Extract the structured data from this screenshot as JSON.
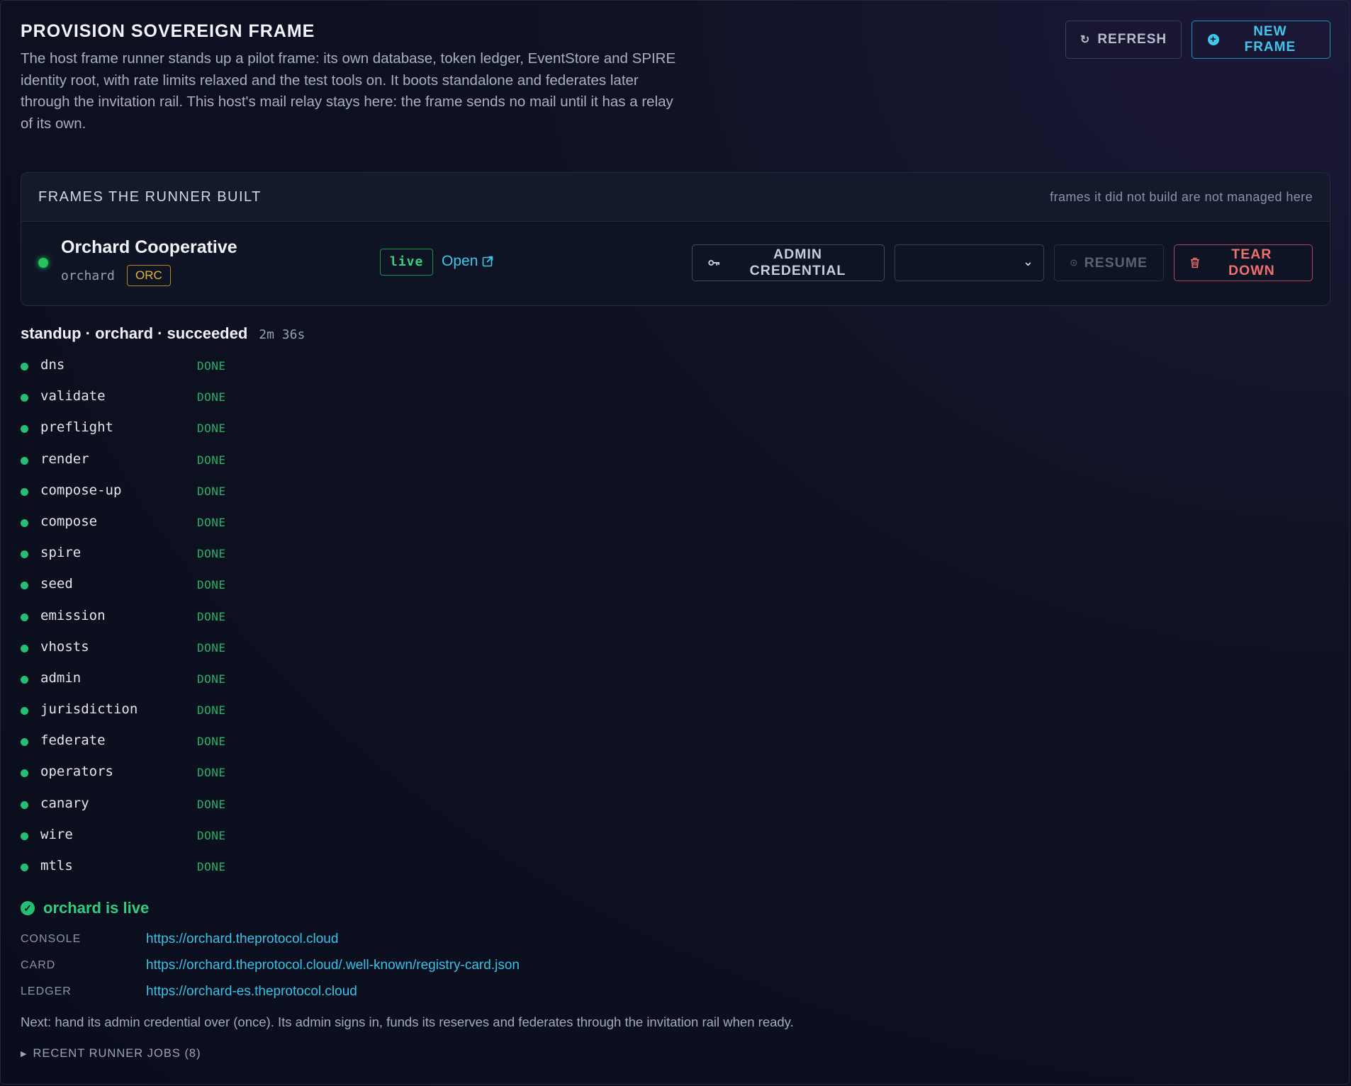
{
  "header": {
    "title": "PROVISION SOVEREIGN FRAME",
    "description": "The host frame runner stands up a pilot frame: its own database, token ledger, EventStore and SPIRE identity root, with rate limits relaxed and the test tools on. It boots standalone and federates later through the invitation rail. This host's mail relay stays here: the frame sends no mail until it has a relay of its own.",
    "refresh_label": "REFRESH",
    "new_frame_label": "NEW FRAME"
  },
  "frames_panel": {
    "title": "FRAMES THE RUNNER BUILT",
    "note": "frames it did not build are not managed here",
    "frame": {
      "name": "Orchard Cooperative",
      "slug": "orchard",
      "tag": "ORC",
      "status": "live",
      "open_label": "Open",
      "admin_label": "ADMIN CREDENTIAL",
      "select_value": "",
      "resume_label": "RESUME",
      "teardown_label": "TEAR DOWN"
    }
  },
  "job": {
    "title": "standup · orchard · succeeded",
    "duration": "2m 36s",
    "steps": [
      {
        "name": "dns",
        "state": "DONE"
      },
      {
        "name": "validate",
        "state": "DONE"
      },
      {
        "name": "preflight",
        "state": "DONE"
      },
      {
        "name": "render",
        "state": "DONE"
      },
      {
        "name": "compose-up",
        "state": "DONE"
      },
      {
        "name": "compose",
        "state": "DONE"
      },
      {
        "name": "spire",
        "state": "DONE"
      },
      {
        "name": "seed",
        "state": "DONE"
      },
      {
        "name": "emission",
        "state": "DONE"
      },
      {
        "name": "vhosts",
        "state": "DONE"
      },
      {
        "name": "admin",
        "state": "DONE"
      },
      {
        "name": "jurisdiction",
        "state": "DONE"
      },
      {
        "name": "federate",
        "state": "DONE"
      },
      {
        "name": "operators",
        "state": "DONE"
      },
      {
        "name": "canary",
        "state": "DONE"
      },
      {
        "name": "wire",
        "state": "DONE"
      },
      {
        "name": "mtls",
        "state": "DONE"
      }
    ]
  },
  "result": {
    "message": "orchard is live",
    "links": [
      {
        "key": "CONSOLE",
        "value": "https://orchard.theprotocol.cloud"
      },
      {
        "key": "CARD",
        "value": "https://orchard.theprotocol.cloud/.well-known/registry-card.json"
      },
      {
        "key": "LEDGER",
        "value": "https://orchard-es.theprotocol.cloud"
      }
    ],
    "next": "Next: hand its admin credential over (once). Its admin signs in, funds its reserves and federates through the invitation rail when ready.",
    "recent_jobs": "RECENT RUNNER JOBS (8)"
  },
  "colors": {
    "accent": "#3fc6ea",
    "success": "#22c073",
    "danger": "#f07070",
    "tag": "#e6b33a"
  }
}
